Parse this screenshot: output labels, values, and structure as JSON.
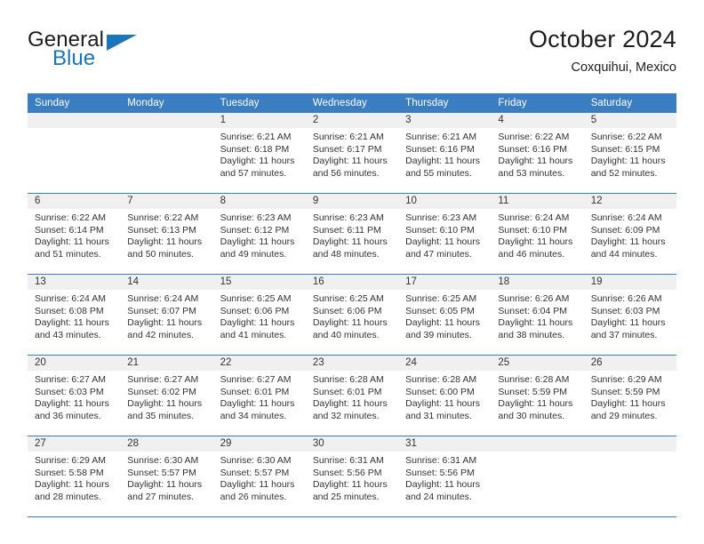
{
  "brand": {
    "line1": "General",
    "line2": "Blue",
    "accent_color": "#1b75bb"
  },
  "header": {
    "title": "October 2024",
    "subtitle": "Coxquihui, Mexico"
  },
  "theme": {
    "header_bg": "#3a7dc0",
    "daynum_bg": "#f0f0f0",
    "text": "#333333"
  },
  "weekdays": [
    "Sunday",
    "Monday",
    "Tuesday",
    "Wednesday",
    "Thursday",
    "Friday",
    "Saturday"
  ],
  "labels": {
    "sunrise": "Sunrise:",
    "sunset": "Sunset:",
    "daylight": "Daylight:"
  },
  "weeks": [
    [
      {
        "day": "",
        "text": ""
      },
      {
        "day": "",
        "text": ""
      },
      {
        "day": "1",
        "text": "Sunrise: 6:21 AM\nSunset: 6:18 PM\nDaylight: 11 hours\nand 57 minutes."
      },
      {
        "day": "2",
        "text": "Sunrise: 6:21 AM\nSunset: 6:17 PM\nDaylight: 11 hours\nand 56 minutes."
      },
      {
        "day": "3",
        "text": "Sunrise: 6:21 AM\nSunset: 6:16 PM\nDaylight: 11 hours\nand 55 minutes."
      },
      {
        "day": "4",
        "text": "Sunrise: 6:22 AM\nSunset: 6:16 PM\nDaylight: 11 hours\nand 53 minutes."
      },
      {
        "day": "5",
        "text": "Sunrise: 6:22 AM\nSunset: 6:15 PM\nDaylight: 11 hours\nand 52 minutes."
      }
    ],
    [
      {
        "day": "6",
        "text": "Sunrise: 6:22 AM\nSunset: 6:14 PM\nDaylight: 11 hours\nand 51 minutes."
      },
      {
        "day": "7",
        "text": "Sunrise: 6:22 AM\nSunset: 6:13 PM\nDaylight: 11 hours\nand 50 minutes."
      },
      {
        "day": "8",
        "text": "Sunrise: 6:23 AM\nSunset: 6:12 PM\nDaylight: 11 hours\nand 49 minutes."
      },
      {
        "day": "9",
        "text": "Sunrise: 6:23 AM\nSunset: 6:11 PM\nDaylight: 11 hours\nand 48 minutes."
      },
      {
        "day": "10",
        "text": "Sunrise: 6:23 AM\nSunset: 6:10 PM\nDaylight: 11 hours\nand 47 minutes."
      },
      {
        "day": "11",
        "text": "Sunrise: 6:24 AM\nSunset: 6:10 PM\nDaylight: 11 hours\nand 46 minutes."
      },
      {
        "day": "12",
        "text": "Sunrise: 6:24 AM\nSunset: 6:09 PM\nDaylight: 11 hours\nand 44 minutes."
      }
    ],
    [
      {
        "day": "13",
        "text": "Sunrise: 6:24 AM\nSunset: 6:08 PM\nDaylight: 11 hours\nand 43 minutes."
      },
      {
        "day": "14",
        "text": "Sunrise: 6:24 AM\nSunset: 6:07 PM\nDaylight: 11 hours\nand 42 minutes."
      },
      {
        "day": "15",
        "text": "Sunrise: 6:25 AM\nSunset: 6:06 PM\nDaylight: 11 hours\nand 41 minutes."
      },
      {
        "day": "16",
        "text": "Sunrise: 6:25 AM\nSunset: 6:06 PM\nDaylight: 11 hours\nand 40 minutes."
      },
      {
        "day": "17",
        "text": "Sunrise: 6:25 AM\nSunset: 6:05 PM\nDaylight: 11 hours\nand 39 minutes."
      },
      {
        "day": "18",
        "text": "Sunrise: 6:26 AM\nSunset: 6:04 PM\nDaylight: 11 hours\nand 38 minutes."
      },
      {
        "day": "19",
        "text": "Sunrise: 6:26 AM\nSunset: 6:03 PM\nDaylight: 11 hours\nand 37 minutes."
      }
    ],
    [
      {
        "day": "20",
        "text": "Sunrise: 6:27 AM\nSunset: 6:03 PM\nDaylight: 11 hours\nand 36 minutes."
      },
      {
        "day": "21",
        "text": "Sunrise: 6:27 AM\nSunset: 6:02 PM\nDaylight: 11 hours\nand 35 minutes."
      },
      {
        "day": "22",
        "text": "Sunrise: 6:27 AM\nSunset: 6:01 PM\nDaylight: 11 hours\nand 34 minutes."
      },
      {
        "day": "23",
        "text": "Sunrise: 6:28 AM\nSunset: 6:01 PM\nDaylight: 11 hours\nand 32 minutes."
      },
      {
        "day": "24",
        "text": "Sunrise: 6:28 AM\nSunset: 6:00 PM\nDaylight: 11 hours\nand 31 minutes."
      },
      {
        "day": "25",
        "text": "Sunrise: 6:28 AM\nSunset: 5:59 PM\nDaylight: 11 hours\nand 30 minutes."
      },
      {
        "day": "26",
        "text": "Sunrise: 6:29 AM\nSunset: 5:59 PM\nDaylight: 11 hours\nand 29 minutes."
      }
    ],
    [
      {
        "day": "27",
        "text": "Sunrise: 6:29 AM\nSunset: 5:58 PM\nDaylight: 11 hours\nand 28 minutes."
      },
      {
        "day": "28",
        "text": "Sunrise: 6:30 AM\nSunset: 5:57 PM\nDaylight: 11 hours\nand 27 minutes."
      },
      {
        "day": "29",
        "text": "Sunrise: 6:30 AM\nSunset: 5:57 PM\nDaylight: 11 hours\nand 26 minutes."
      },
      {
        "day": "30",
        "text": "Sunrise: 6:31 AM\nSunset: 5:56 PM\nDaylight: 11 hours\nand 25 minutes."
      },
      {
        "day": "31",
        "text": "Sunrise: 6:31 AM\nSunset: 5:56 PM\nDaylight: 11 hours\nand 24 minutes."
      },
      {
        "day": "",
        "text": ""
      },
      {
        "day": "",
        "text": ""
      }
    ]
  ]
}
